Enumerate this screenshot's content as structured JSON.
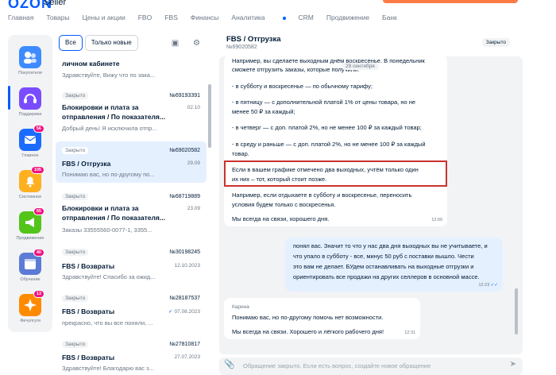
{
  "app": {
    "logo": "OZON",
    "logo_sub": "Seller"
  },
  "nav": [
    "Главная",
    "Товары",
    "Цены и акции",
    "FBO",
    "FBS",
    "Финансы",
    "Аналитика",
    "CRM",
    "Продвижение",
    "Банк"
  ],
  "rail": [
    {
      "label": "Покупатели",
      "icon": "users-icon",
      "badge": ""
    },
    {
      "label": "Поддержка",
      "icon": "headset-icon",
      "badge": ""
    },
    {
      "label": "Главное",
      "icon": "mail-icon",
      "badge": "56"
    },
    {
      "label": "Системное",
      "icon": "bell-icon",
      "badge": "105"
    },
    {
      "label": "Продвижение",
      "icon": "megaphone-icon",
      "badge": "65"
    },
    {
      "label": "Обучение",
      "icon": "calendar-icon",
      "badge": "40"
    },
    {
      "label": "Фичулгуги",
      "icon": "sparkle-icon",
      "badge": "13"
    }
  ],
  "filters": {
    "all": "Все",
    "new": "Только новые"
  },
  "list": [
    {
      "status": "",
      "num": "",
      "title": "личном кабинете",
      "date": "",
      "preview": "Здравствуйте, Вижу что по зака..."
    },
    {
      "status": "Закрыто",
      "num": "№69193391",
      "title": "Блокировки и плата за отправления / По показателя...",
      "date": "02.10",
      "preview": "Добрый день! Я исключила отпр..."
    },
    {
      "status": "Закрыто",
      "num": "№69020582",
      "title": "FBS / Отгрузка",
      "date": "29.09",
      "preview": "Понимаю вас, но по-другому по..."
    },
    {
      "status": "Закрыто",
      "num": "№68719889",
      "title": "Блокировки и плата за отправления / По показателя...",
      "date": "23.09",
      "preview": "Заказы 33555560-0077-1, 3355..."
    },
    {
      "status": "Закрыто",
      "num": "№30198245",
      "title": "FBS / Возвраты",
      "date": "12.10.2023",
      "preview": "Здравствуйте! Спасибо за ожид..."
    },
    {
      "status": "Закрыто",
      "num": "№28187537",
      "title": "FBS / Возвраты",
      "date": "07.08.2023",
      "preview": "прекрасно, что вы все поняли, ..."
    },
    {
      "status": "Закрыто",
      "num": "№27810817",
      "title": "FBS / Возвраты",
      "date": "27.07.2023",
      "preview": "Здравствуйте! Благодарю вас з..."
    }
  ],
  "chat": {
    "title": "FBS / Отгрузка",
    "num": "№69020582",
    "status": "Закрыто",
    "date_chip": "29 сентября",
    "msg1": {
      "lines": [
        "Например, вы сделаете выходным днём воскресенье. В понедельник",
        "сможете отгрузить заказы, которые получили:",
        "- в субботу и воскресенье — по обычному тарифу;",
        "- в пятницу — с дополнительной платой 1% от цены товара, но не",
        "менее 50 ₽ за каждый;",
        "- в четверг — с доп. платой 2%, но не менее 100 ₽ за каждый товар;",
        "- в среду и раньше — с доп. платой 2%, но не менее 100 ₽ за каждый",
        "товар.",
        "Если в вашем графике отмечено два выходных, учтём только один",
        "их них – тот, который стоит позже.",
        "Например, если отдыхаете в субботу и воскресенье, переносить",
        "условия будем только с воскресенья.",
        "Мы всегда на связи, хорошего дня."
      ],
      "time": "12:00"
    },
    "msg2": {
      "lines": [
        "понял вас. Значит то что у нас два дня выходных вы не учитываете, и",
        "что упало в субботу - все, минус 50 руб с поставки вышло. Чести",
        "это вам не делает. БУдем останавливать на выходные отгрузки и",
        "ориентировать все продажи на других селлеров в основной массе."
      ],
      "time": "12:23"
    },
    "msg3": {
      "sender": "Карина",
      "lines": [
        "Понимаю вас, но по-другому помочь нет возможности.",
        "Мы всегда на связи. Хорошего и лёгкого рабочего дня!"
      ],
      "time": "12:31"
    },
    "input_placeholder": "Обращение закрыто. Если есть вопрос, создайте новое обращение"
  },
  "colors": {
    "accent": "#005bff",
    "badge": "#f1117e",
    "highlight": "#c8332f"
  }
}
